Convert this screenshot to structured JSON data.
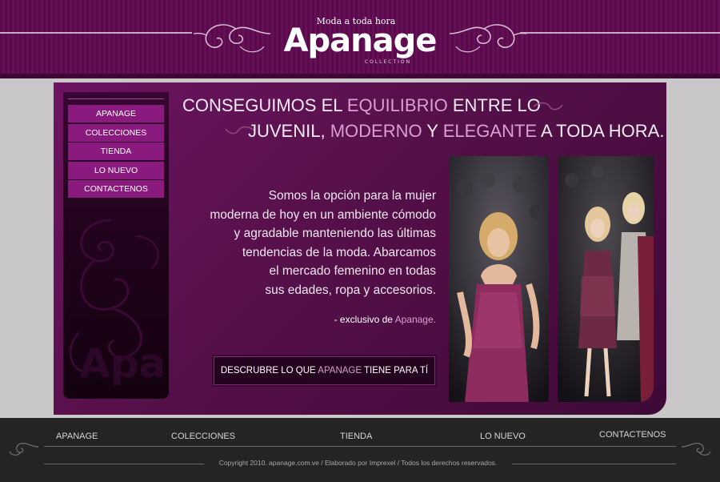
{
  "brand": {
    "tagline": "Moda a toda hora",
    "name": "Apanage",
    "subtitle": "COLLECTION",
    "watermark": "Apa"
  },
  "sidebar": {
    "items": [
      {
        "label": "APANAGE"
      },
      {
        "label": "COLECCIONES"
      },
      {
        "label": "TIENDA"
      },
      {
        "label": "LO NUEVO"
      },
      {
        "label": "CONTACTENOS"
      }
    ]
  },
  "headline": {
    "line1_a": "CONSEGUIMOS EL ",
    "line1_hl": "EQUILIBRIO",
    "line1_b": " ENTRE LO",
    "line2_a": "JUVENIL, ",
    "line2_hl1": "MODERNO",
    "line2_b": " Y ",
    "line2_hl2": "ELEGANTE",
    "line2_c": " A TODA HORA."
  },
  "body": {
    "lines": [
      "Somos la opción para la mujer",
      "moderna de hoy en un ambiente cómodo",
      "y agradable manteniendo las últimas",
      "tendencias de la moda. Abarcamos",
      "el mercado femenino en todas",
      "sus edades, ropa y accesorios."
    ],
    "signature_a": "- exclusivo de ",
    "signature_hl": "Apanage."
  },
  "cta": {
    "a": "DESCRUBRE LO QUE ",
    "hl": "APANAGE",
    "b": " TIENE PARA TÍ"
  },
  "footer": {
    "nav": [
      {
        "label": "APANAGE"
      },
      {
        "label": "COLECCIONES"
      },
      {
        "label": "TIENDA"
      },
      {
        "label": "LO NUEVO"
      },
      {
        "label": "CONTACTENOS"
      }
    ],
    "copyright": "Copyright 2010. apanage.com.ve / Elaborado por Imprexel / Todos los derechos reservados."
  },
  "colors": {
    "accent": "#d99fd0",
    "menu_bg": "#8a1a7e",
    "header_bg": "#5a0a4c",
    "footer_bg": "#242424"
  }
}
